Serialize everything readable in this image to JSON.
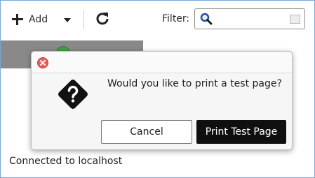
{
  "toolbar": {
    "add_label": "Add",
    "add_icon": "plus-icon",
    "dropdown_icon": "chevron-down-icon",
    "refresh_icon": "refresh-icon",
    "filter_label": "Filter:",
    "filter_value": "",
    "filter_icon": "search-icon",
    "clear_icon": "clear-icon"
  },
  "status": {
    "text": "Connected to localhost"
  },
  "dialog": {
    "message": "Would you like to print a test page?",
    "icon": "question-icon",
    "close_icon": "close-icon",
    "cancel_label": "Cancel",
    "confirm_label": "Print Test Page"
  },
  "colors": {
    "accent_border": "#7aa6d6",
    "close_button": "#e85a5a",
    "primary_button": "#0f0f0f",
    "selection_area": "#898989",
    "printer_status": "#3fa13f"
  }
}
